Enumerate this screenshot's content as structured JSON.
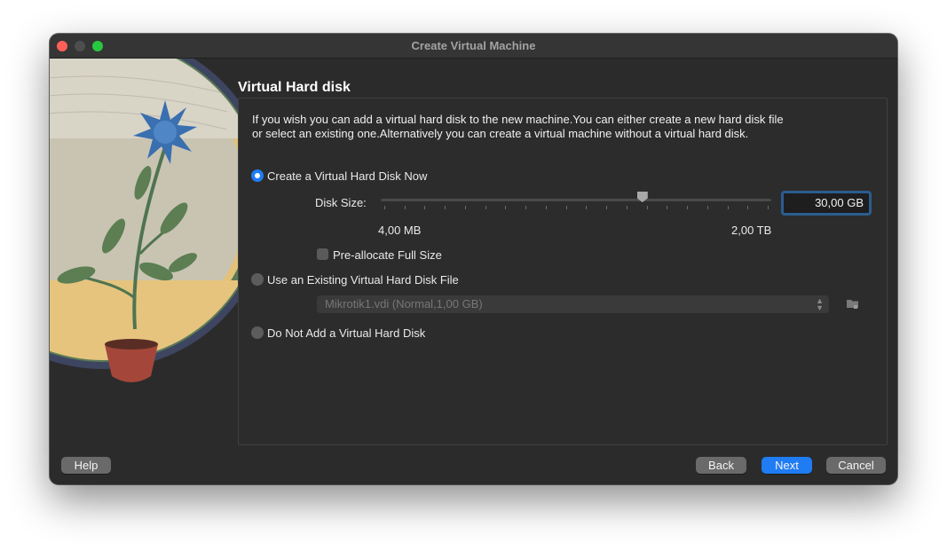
{
  "window": {
    "title": "Create Virtual Machine"
  },
  "page": {
    "heading": "Virtual Hard disk",
    "description": "If you wish you can add a virtual hard disk to the new machine.You can either create a new hard disk file or select an existing one.Alternatively you can create a virtual machine without a virtual hard disk."
  },
  "options": {
    "create_now": {
      "label": "Create a Virtual Hard Disk Now",
      "selected": true
    },
    "use_existing": {
      "label": "Use an Existing Virtual Hard Disk File",
      "selected": false
    },
    "none": {
      "label": "Do Not Add a Virtual Hard Disk",
      "selected": false
    }
  },
  "disk_size": {
    "label": "Disk Size:",
    "value": "30,00 GB",
    "slider_fraction": 0.67,
    "min_label": "4,00 MB",
    "max_label": "2,00 TB",
    "tick_count": 20
  },
  "preallocate": {
    "label": "Pre-allocate Full Size",
    "checked": false
  },
  "existing_file": {
    "selected": "Mikrotik1.vdi (Normal,1,00 GB)"
  },
  "buttons": {
    "help": "Help",
    "back": "Back",
    "next": "Next",
    "cancel": "Cancel"
  },
  "colors": {
    "accent": "#1f7cf3",
    "window_bg": "#2b2b2b",
    "close": "#fe5f57",
    "zoom": "#28c840"
  }
}
